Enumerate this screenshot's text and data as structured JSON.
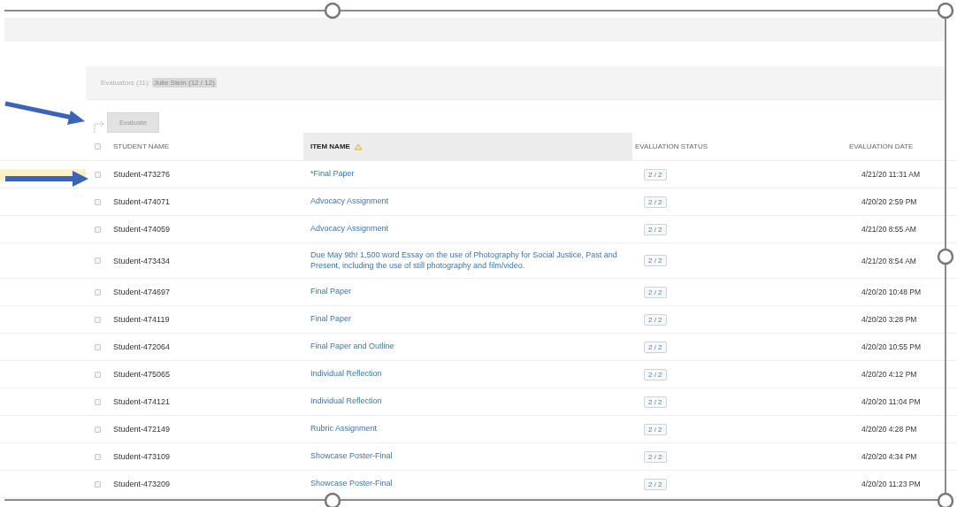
{
  "evaluators": {
    "label": "Evaluators (11):",
    "current": "Julie Stein (12 / 12)"
  },
  "evaluate_button": "Evaluate",
  "select_all": {
    "checked": false
  },
  "columns": [
    {
      "label": "STUDENT NAME",
      "sorted": false
    },
    {
      "label": "ITEM NAME",
      "sorted": true
    },
    {
      "label": "EVALUATION STATUS",
      "sorted": false
    },
    {
      "label": "EVALUATION DATE",
      "sorted": false
    }
  ],
  "rows": [
    {
      "checked": false,
      "highlighted": true,
      "student": "Student-473276",
      "item": "*Final Paper",
      "status": "2 / 2",
      "date": "4/21/20 11:31 AM"
    },
    {
      "checked": false,
      "highlighted": false,
      "student": "Student-474071",
      "item": "Advocacy Assignment",
      "status": "2 / 2",
      "date": "4/20/20 2:59 PM"
    },
    {
      "checked": false,
      "highlighted": false,
      "student": "Student-474059",
      "item": "Advocacy Assignment",
      "status": "2 / 2",
      "date": "4/21/20 8:55 AM"
    },
    {
      "checked": false,
      "highlighted": false,
      "student": "Student-473434",
      "item": "Due May 9th! 1,500 word Essay on the use of Photography for Social Justice, Past and Present, including the use of still photography and film/video.",
      "status": "2 / 2",
      "date": "4/21/20 8:54 AM"
    },
    {
      "checked": false,
      "highlighted": false,
      "student": "Student-474697",
      "item": "Final Paper",
      "status": "2 / 2",
      "date": "4/20/20 10:48 PM"
    },
    {
      "checked": false,
      "highlighted": false,
      "student": "Student-474119",
      "item": "Final Paper",
      "status": "2 / 2",
      "date": "4/20/20 3:28 PM"
    },
    {
      "checked": false,
      "highlighted": false,
      "student": "Student-472064",
      "item": "Final Paper and Outline",
      "status": "2 / 2",
      "date": "4/20/20 10:55 PM"
    },
    {
      "checked": false,
      "highlighted": false,
      "student": "Student-475065",
      "item": "Individual Reflection",
      "status": "2 / 2",
      "date": "4/20/20 4:12 PM"
    },
    {
      "checked": false,
      "highlighted": false,
      "student": "Student-474121",
      "item": "Individual Reflection",
      "status": "2 / 2",
      "date": "4/20/20 11:04 PM"
    },
    {
      "checked": false,
      "highlighted": false,
      "student": "Student-472149",
      "item": "Rubric Assignment",
      "status": "2 / 2",
      "date": "4/20/20 4:28 PM"
    },
    {
      "checked": false,
      "highlighted": false,
      "student": "Student-473109",
      "item": "Showcase Poster-Final",
      "status": "2 / 2",
      "date": "4/20/20 4:34 PM"
    },
    {
      "checked": false,
      "highlighted": false,
      "student": "Student-473209",
      "item": "Showcase Poster-Final",
      "status": "2 / 2",
      "date": "4/20/20 11:23 PM"
    }
  ]
}
